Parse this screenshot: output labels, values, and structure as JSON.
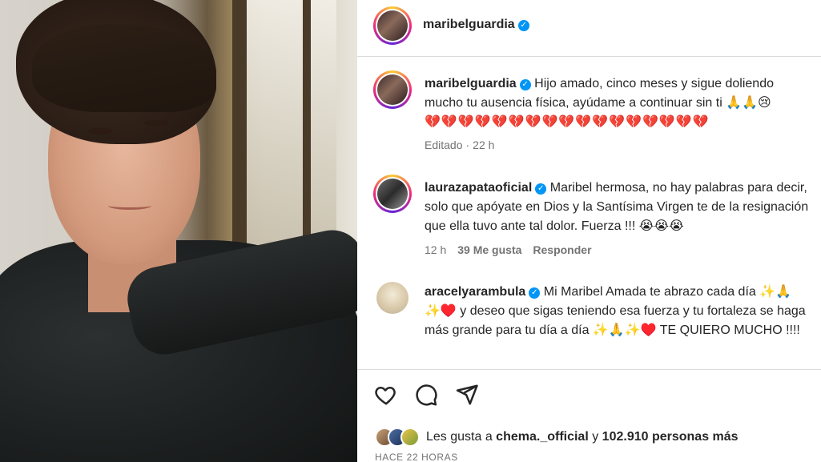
{
  "header": {
    "username": "maribelguardia"
  },
  "comments": [
    {
      "username": "maribelguardia",
      "text": "Hijo amado, cinco meses y sigue doliendo mucho tu ausencia física, ayúdame a continuar sin ti 🙏🙏😢",
      "hearts": "💔💔💔💔💔💔💔💔💔💔💔💔💔💔💔💔💔",
      "edited_label": "Editado",
      "time": "22 h"
    },
    {
      "username": "laurazapataoficial",
      "text": "Maribel hermosa, no hay palabras para decir, solo que apóyate en Dios y la Santísima Virgen te de la resignación que ella tuvo ante tal dolor. Fuerza !!! 😭😭😭",
      "time": "12 h",
      "likes": "39 Me gusta",
      "reply_label": "Responder"
    },
    {
      "username": "aracelyarambula",
      "text": "Mi Maribel Amada te abrazo cada día ✨🙏✨♥️ y deseo que sigas teniendo esa fuerza y tu fortaleza se haga más grande para tu día a día ✨🙏✨♥️ TE QUIERO MUCHO !!!!"
    }
  ],
  "actions": {
    "like_icon": "heart-icon",
    "comment_icon": "comment-icon",
    "share_icon": "share-icon"
  },
  "likes": {
    "prefix": "Les gusta a ",
    "user": "chema._official",
    "middle": " y ",
    "count": "102.910 personas más"
  },
  "timestamp": "HACE 22 HORAS",
  "colors": {
    "verified": "#0095f6",
    "heart": "#e0245e",
    "muted": "#737373"
  }
}
